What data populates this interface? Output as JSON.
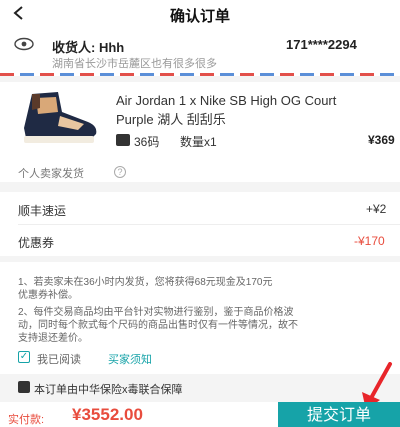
{
  "header": {
    "title": "确认订单"
  },
  "address": {
    "recipient": "收货人: Hhh",
    "phone": "171****2294",
    "detail": "湖南省长沙市岳麓区也有很多很多"
  },
  "product": {
    "name_line1": "Air Jordan 1 x Nike SB High OG Court",
    "name_line2": "Purple 湖人 刮刮乐",
    "size": "36码",
    "quantity": "数量x1",
    "price": "¥369",
    "seller": "个人卖家发货"
  },
  "fees": [
    {
      "label": "顺丰速运",
      "value": "+¥2"
    },
    {
      "label": "优惠券",
      "value": "-¥170"
    }
  ],
  "notices": [
    "1、若卖家未在36小时内发货，您将获得68元现金及170元",
    "优惠券补偿。",
    "2、每件交易商品均由平台针对实物进行鉴别，鉴于商品价格波",
    "动，同时每个款式每个尺码的商品出售时仅有一件等情况，故不",
    "支持退还差价。"
  ],
  "agreement": {
    "label": "我已阅读",
    "link": "买家须知"
  },
  "insurance": "本订单由中华保险x毒联合保障",
  "footer": {
    "pay_label": "实付款:",
    "amount": "¥3552.00",
    "submit": "提交订单"
  },
  "colors": {
    "accent": "#16a3a8",
    "price_red": "#e84c3d"
  }
}
